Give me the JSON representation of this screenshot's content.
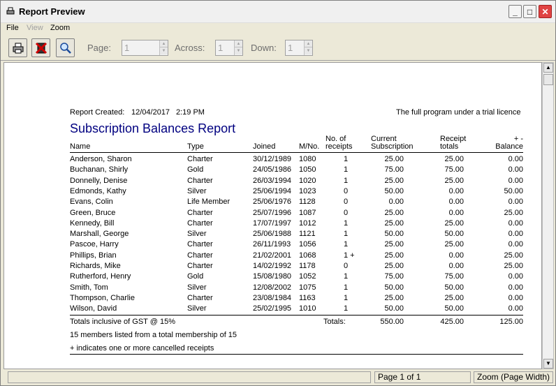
{
  "window": {
    "title": "Report Preview",
    "title_icon": "printer-icon",
    "buttons": {
      "minimize": "minimize-icon",
      "maximize": "maximize-icon",
      "close": "close-icon"
    }
  },
  "menu": {
    "file": "File",
    "view": "View",
    "zoom": "Zoom"
  },
  "toolbar": {
    "print_icon": "printer-icon",
    "close_icon": "close-preview-icon",
    "zoom_icon": "magnifier-icon",
    "page_label": "Page:",
    "page_value": "1",
    "across_label": "Across:",
    "across_value": "1",
    "down_label": "Down:",
    "down_value": "1"
  },
  "report": {
    "created_label": "Report Created:",
    "created_date": "12/04/2017",
    "created_time": "2:19 PM",
    "licence_note": "The full program under a trial licence",
    "title": "Subscription Balances Report",
    "columns": {
      "name": "Name",
      "type": "Type",
      "joined": "Joined",
      "mno": "M/No.",
      "receipts_1": "No. of",
      "receipts_2": "receipts",
      "current_1": "Current",
      "current_2": "Subscription",
      "rtotals_1": "Receipt",
      "rtotals_2": "totals",
      "balance_1": "+ -",
      "balance_2": "Balance"
    },
    "rows": [
      {
        "name": "Anderson, Sharon",
        "type": "Charter",
        "joined": "30/12/1989",
        "mno": "1080",
        "receipts": "1",
        "current": "25.00",
        "rtotal": "25.00",
        "balance": "0.00"
      },
      {
        "name": "Buchanan, Shirly",
        "type": "Gold",
        "joined": "24/05/1986",
        "mno": "1050",
        "receipts": "1",
        "current": "75.00",
        "rtotal": "75.00",
        "balance": "0.00"
      },
      {
        "name": "Donnelly, Denise",
        "type": "Charter",
        "joined": "26/03/1994",
        "mno": "1020",
        "receipts": "1",
        "current": "25.00",
        "rtotal": "25.00",
        "balance": "0.00"
      },
      {
        "name": "Edmonds, Kathy",
        "type": "Silver",
        "joined": "25/06/1994",
        "mno": "1023",
        "receipts": "0",
        "current": "50.00",
        "rtotal": "0.00",
        "balance": "50.00"
      },
      {
        "name": "Evans, Colin",
        "type": "Life Member",
        "joined": "25/06/1976",
        "mno": "1128",
        "receipts": "0",
        "current": "0.00",
        "rtotal": "0.00",
        "balance": "0.00"
      },
      {
        "name": "Green, Bruce",
        "type": "Charter",
        "joined": "25/07/1996",
        "mno": "1087",
        "receipts": "0",
        "current": "25.00",
        "rtotal": "0.00",
        "balance": "25.00"
      },
      {
        "name": "Kennedy, Bill",
        "type": "Charter",
        "joined": "17/07/1997",
        "mno": "1012",
        "receipts": "1",
        "current": "25.00",
        "rtotal": "25.00",
        "balance": "0.00"
      },
      {
        "name": "Marshall, George",
        "type": "Silver",
        "joined": "25/06/1988",
        "mno": "1121",
        "receipts": "1",
        "current": "50.00",
        "rtotal": "50.00",
        "balance": "0.00"
      },
      {
        "name": "Pascoe, Harry",
        "type": "Charter",
        "joined": "26/11/1993",
        "mno": "1056",
        "receipts": "1",
        "current": "25.00",
        "rtotal": "25.00",
        "balance": "0.00"
      },
      {
        "name": "Phillips, Brian",
        "type": "Charter",
        "joined": "21/02/2001",
        "mno": "1068",
        "receipts": "1 +",
        "current": "25.00",
        "rtotal": "0.00",
        "balance": "25.00"
      },
      {
        "name": "Richards, Mike",
        "type": "Charter",
        "joined": "14/02/1992",
        "mno": "1178",
        "receipts": "0",
        "current": "25.00",
        "rtotal": "0.00",
        "balance": "25.00"
      },
      {
        "name": "Rutherford, Henry",
        "type": "Gold",
        "joined": "15/08/1980",
        "mno": "1052",
        "receipts": "1",
        "current": "75.00",
        "rtotal": "75.00",
        "balance": "0.00"
      },
      {
        "name": "Smith, Tom",
        "type": "Silver",
        "joined": "12/08/2002",
        "mno": "1075",
        "receipts": "1",
        "current": "50.00",
        "rtotal": "50.00",
        "balance": "0.00"
      },
      {
        "name": "Thompson, Charlie",
        "type": "Charter",
        "joined": "23/08/1984",
        "mno": "1163",
        "receipts": "1",
        "current": "25.00",
        "rtotal": "25.00",
        "balance": "0.00"
      },
      {
        "name": "Wilson, David",
        "type": "Silver",
        "joined": "25/02/1995",
        "mno": "1010",
        "receipts": "1",
        "current": "50.00",
        "rtotal": "50.00",
        "balance": "0.00"
      }
    ],
    "gst_note": "Totals inclusive of GST @ 15%",
    "totals_label": "Totals:",
    "total_current": "550.00",
    "total_receipts": "425.00",
    "total_balance": "125.00",
    "members_note": "15 members listed from a total membership of 15",
    "cancelled_note": "+ indicates one or more cancelled receipts"
  },
  "status": {
    "page": "Page 1 of 1",
    "zoom": "Zoom (Page Width)"
  }
}
